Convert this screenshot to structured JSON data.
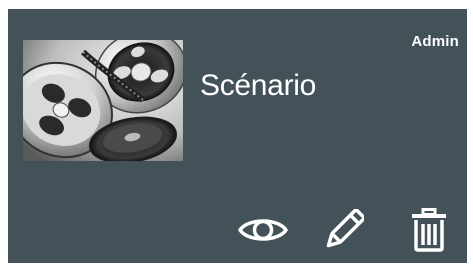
{
  "card": {
    "role_badge": "Admin",
    "title": "Scénario",
    "thumbnail_icon": "film-reel-icon",
    "actions": [
      {
        "name": "view",
        "icon": "eye-icon"
      },
      {
        "name": "edit",
        "icon": "pencil-icon"
      },
      {
        "name": "delete",
        "icon": "trash-icon"
      }
    ]
  },
  "colors": {
    "card_background": "#435158",
    "text": "#ffffff"
  }
}
